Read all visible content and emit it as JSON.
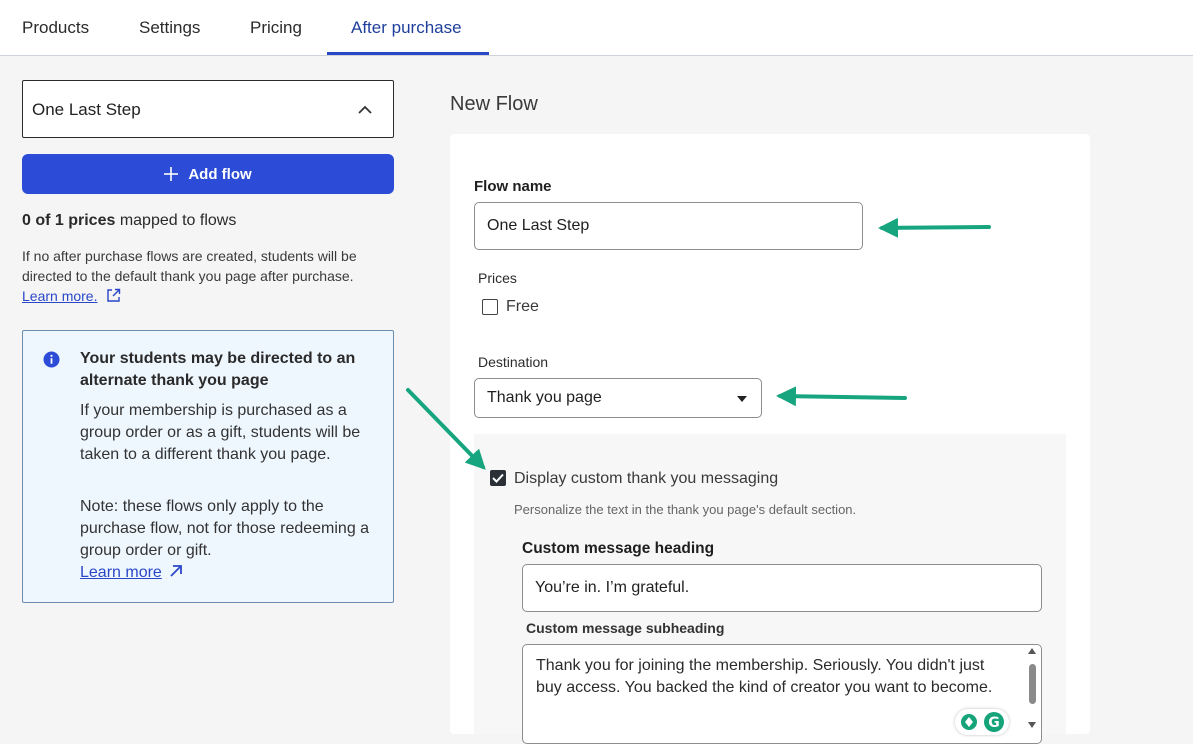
{
  "tabs": [
    {
      "label": "Products"
    },
    {
      "label": "Settings"
    },
    {
      "label": "Pricing"
    },
    {
      "label": "After purchase",
      "active": true
    }
  ],
  "sidebar": {
    "selected_flow": "One Last Step",
    "add_flow_label": "Add flow",
    "mapped_count": "0 of 1 prices",
    "mapped_suffix": "mapped to flows",
    "help_text": "If no after purchase flows are created, students will be directed to the default thank you page after purchase.",
    "help_link": "Learn more.",
    "info": {
      "title": "Your students may be directed to an alternate thank you page",
      "body1": "If your membership is purchased as a group order or as a gift, students will be taken to a different thank you page.",
      "body2": "Note: these flows only apply to the purchase flow, not for those redeeming a group order or gift.",
      "link": "Learn more"
    }
  },
  "form": {
    "heading": "New Flow",
    "flow_name_label": "Flow name",
    "flow_name_value": "One Last Step",
    "prices_label": "Prices",
    "price_option": "Free",
    "price_checked": false,
    "destination_label": "Destination",
    "destination_value": "Thank you page",
    "custom_msg_checkbox": "Display custom thank you messaging",
    "custom_msg_checked": true,
    "custom_msg_help": "Personalize the text in the thank you page's default section.",
    "heading_label": "Custom message heading",
    "heading_value": "You’re in. I’m grateful.",
    "subheading_label": "Custom message subheading",
    "subheading_value": "Thank you for joining the membership. Seriously. You didn't just buy access. You backed the kind of creator you want to become."
  },
  "colors": {
    "accent": "#2c4bd6",
    "annotation_arrow": "#17a57f",
    "info_bg": "#eef6fe"
  }
}
